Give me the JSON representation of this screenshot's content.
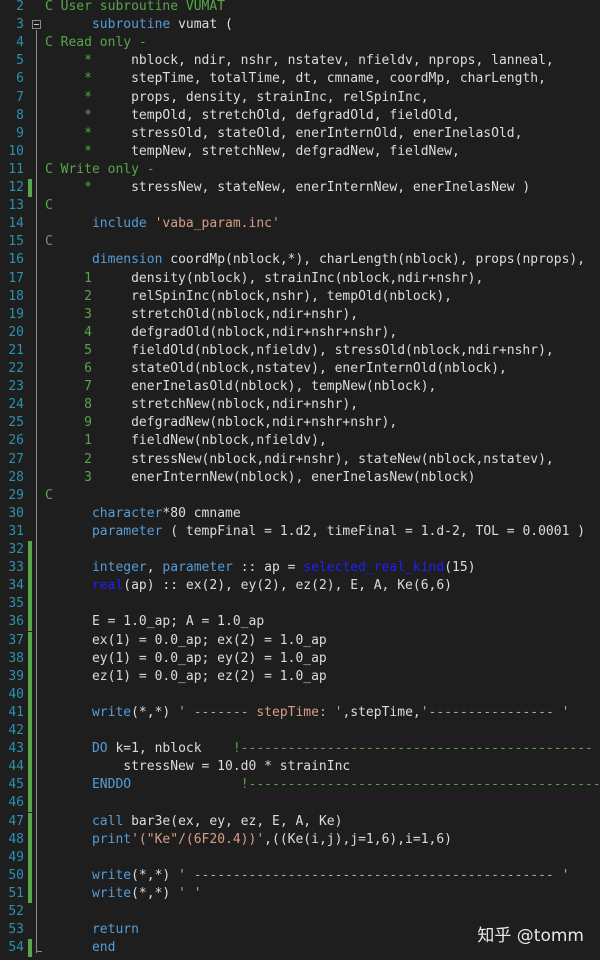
{
  "editor": {
    "lines": [
      {
        "n": "2",
        "t": "C User subroutine VUMAT",
        "cls": "c",
        "chg": false
      },
      {
        "n": "3",
        "t": "      subroutine vumat (",
        "cls": "kw1",
        "chg": false
      },
      {
        "n": "4",
        "t": "C Read only -",
        "cls": "c",
        "chg": false
      },
      {
        "n": "5",
        "t": "     *     nblock, ndir, nshr, nstatev, nfieldv, nprops, lanneal,",
        "cls": "cont",
        "chg": false
      },
      {
        "n": "6",
        "t": "     *     stepTime, totalTime, dt, cmname, coordMp, charLength,",
        "cls": "cont",
        "chg": false
      },
      {
        "n": "7",
        "t": "     *     props, density, strainInc, relSpinInc,",
        "cls": "cont",
        "chg": false
      },
      {
        "n": "8",
        "t": "     *     tempOld, stretchOld, defgradOld, fieldOld,",
        "cls": "cont",
        "chg": false
      },
      {
        "n": "9",
        "t": "     *     stressOld, stateOld, enerInternOld, enerInelasOld,",
        "cls": "cont",
        "chg": false
      },
      {
        "n": "10",
        "t": "     *     tempNew, stretchNew, defgradNew, fieldNew,",
        "cls": "cont",
        "chg": false
      },
      {
        "n": "11",
        "t": "C Write only -",
        "cls": "c",
        "chg": false
      },
      {
        "n": "12",
        "t": "     *     stressNew, stateNew, enerInternNew, enerInelasNew )",
        "cls": "cont",
        "chg": true
      },
      {
        "n": "13",
        "t": "C",
        "cls": "c",
        "chg": false
      },
      {
        "n": "14",
        "t": "      include 'vaba_param.inc'",
        "cls": "include",
        "chg": false
      },
      {
        "n": "15",
        "t": "C",
        "cls": "c",
        "chg": false
      },
      {
        "n": "16",
        "t": "      dimension coordMp(nblock,*), charLength(nblock), props(nprops),",
        "cls": "dim",
        "chg": false
      },
      {
        "n": "17",
        "t": "     1     density(nblock), strainInc(nblock,ndir+nshr),",
        "cls": "cont",
        "chg": false
      },
      {
        "n": "18",
        "t": "     2     relSpinInc(nblock,nshr), tempOld(nblock),",
        "cls": "cont",
        "chg": false
      },
      {
        "n": "19",
        "t": "     3     stretchOld(nblock,ndir+nshr),",
        "cls": "cont",
        "chg": false
      },
      {
        "n": "20",
        "t": "     4     defgradOld(nblock,ndir+nshr+nshr),",
        "cls": "cont",
        "chg": false
      },
      {
        "n": "21",
        "t": "     5     fieldOld(nblock,nfieldv), stressOld(nblock,ndir+nshr),",
        "cls": "cont",
        "chg": false
      },
      {
        "n": "22",
        "t": "     6     stateOld(nblock,nstatev), enerInternOld(nblock),",
        "cls": "cont",
        "chg": false
      },
      {
        "n": "23",
        "t": "     7     enerInelasOld(nblock), tempNew(nblock),",
        "cls": "cont",
        "chg": false
      },
      {
        "n": "24",
        "t": "     8     stretchNew(nblock,ndir+nshr),",
        "cls": "cont",
        "chg": false
      },
      {
        "n": "25",
        "t": "     9     defgradNew(nblock,ndir+nshr+nshr),",
        "cls": "cont",
        "chg": false
      },
      {
        "n": "26",
        "t": "     1     fieldNew(nblock,nfieldv),",
        "cls": "cont",
        "chg": false
      },
      {
        "n": "27",
        "t": "     2     stressNew(nblock,ndir+nshr), stateNew(nblock,nstatev),",
        "cls": "cont",
        "chg": false
      },
      {
        "n": "28",
        "t": "     3     enerInternNew(nblock), enerInelasNew(nblock)",
        "cls": "cont",
        "chg": false
      },
      {
        "n": "29",
        "t": "C",
        "cls": "c",
        "chg": false
      },
      {
        "n": "30",
        "t": "      character*80 cmname",
        "cls": "char",
        "chg": false
      },
      {
        "n": "31",
        "t": "      parameter ( tempFinal = 1.d2, timeFinal = 1.d-2, TOL = 0.0001 )",
        "cls": "param",
        "chg": false
      },
      {
        "n": "32",
        "t": "",
        "cls": "plain",
        "chg": true
      },
      {
        "n": "33",
        "t": "      integer, parameter :: ap = selected_real_kind(15)",
        "cls": "intp",
        "chg": true
      },
      {
        "n": "34",
        "t": "      real(ap) :: ex(2), ey(2), ez(2), E, A, Ke(6,6)",
        "cls": "real",
        "chg": true
      },
      {
        "n": "35",
        "t": "",
        "cls": "plain",
        "chg": true
      },
      {
        "n": "36",
        "t": "      E = 1.0_ap; A = 1.0_ap",
        "cls": "plain",
        "chg": true
      },
      {
        "n": "37",
        "t": "      ex(1) = 0.0_ap; ex(2) = 1.0_ap",
        "cls": "plain",
        "chg": true
      },
      {
        "n": "38",
        "t": "      ey(1) = 0.0_ap; ey(2) = 1.0_ap",
        "cls": "plain",
        "chg": true
      },
      {
        "n": "39",
        "t": "      ez(1) = 0.0_ap; ez(2) = 1.0_ap",
        "cls": "plain",
        "chg": true
      },
      {
        "n": "40",
        "t": "",
        "cls": "plain",
        "chg": true
      },
      {
        "n": "41",
        "t": "      write(*,*) ' ------- stepTime: ',stepTime,'---------------- '",
        "cls": "write1",
        "chg": true
      },
      {
        "n": "42",
        "t": "",
        "cls": "plain",
        "chg": true
      },
      {
        "n": "43",
        "t": "      DO k=1, nblock    !---------------------------------------------",
        "cls": "do",
        "chg": true
      },
      {
        "n": "44",
        "t": "          stressNew = 10.d0 * strainInc",
        "cls": "plain",
        "chg": true
      },
      {
        "n": "45",
        "t": "      ENDDO              !---------------------------------------------",
        "cls": "enddo",
        "chg": true
      },
      {
        "n": "46",
        "t": "",
        "cls": "plain",
        "chg": true
      },
      {
        "n": "47",
        "t": "      call bar3e(ex, ey, ez, E, A, Ke)",
        "cls": "call",
        "chg": true
      },
      {
        "n": "48",
        "t": "      print'(\"Ke\"/(6F20.4))',((Ke(i,j),j=1,6),i=1,6)",
        "cls": "print",
        "chg": true
      },
      {
        "n": "49",
        "t": "",
        "cls": "plain",
        "chg": true
      },
      {
        "n": "50",
        "t": "      write(*,*) ' ---------------------------------------------- '",
        "cls": "write2",
        "chg": true
      },
      {
        "n": "51",
        "t": "      write(*,*) ' '",
        "cls": "write3",
        "chg": true
      },
      {
        "n": "52",
        "t": "",
        "cls": "plain",
        "chg": false
      },
      {
        "n": "53",
        "t": "      return",
        "cls": "ret",
        "chg": false
      },
      {
        "n": "54",
        "t": "      end",
        "cls": "end",
        "chg": true
      }
    ]
  },
  "watermark": {
    "text": "知乎 @tomm"
  },
  "colors": {
    "keyword": "#569cd6",
    "comment": "#57a64a",
    "string": "#d69d85",
    "line_number": "#2b91af",
    "change_bar": "#57a64a"
  }
}
